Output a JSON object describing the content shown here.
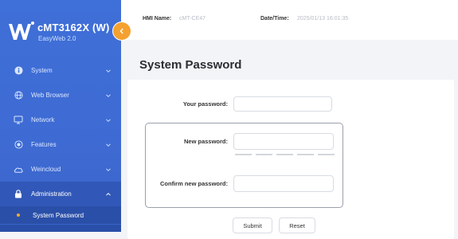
{
  "brand": {
    "model": "cMT3162X (W)",
    "subtitle": "EasyWeb 2.0"
  },
  "sidebar": {
    "items": [
      {
        "label": "System",
        "icon": "info-icon"
      },
      {
        "label": "Web Browser",
        "icon": "globe-icon"
      },
      {
        "label": "Network",
        "icon": "network-icon"
      },
      {
        "label": "Features",
        "icon": "features-icon"
      },
      {
        "label": "Weincloud",
        "icon": "cloud-icon"
      },
      {
        "label": "Administration",
        "icon": "lock-icon"
      }
    ],
    "sub_items": [
      {
        "label": "System Password"
      }
    ]
  },
  "header": {
    "hmi_name_label": "HMI Name:",
    "hmi_name_value": "cMT-CE47",
    "datetime_label": "Date/Time:",
    "datetime_value": "2025/01/13 16:01:35"
  },
  "page": {
    "title": "System Password"
  },
  "form": {
    "your_password_label": "Your password:",
    "new_password_label": "New password:",
    "confirm_password_label": "Confirm new password:",
    "submit_label": "Submit",
    "reset_label": "Reset"
  },
  "colors": {
    "sidebar": "#3f6fd8",
    "accent": "#f5a130",
    "active_item": "#3158b8",
    "sub_item": "#2a4fa8"
  }
}
